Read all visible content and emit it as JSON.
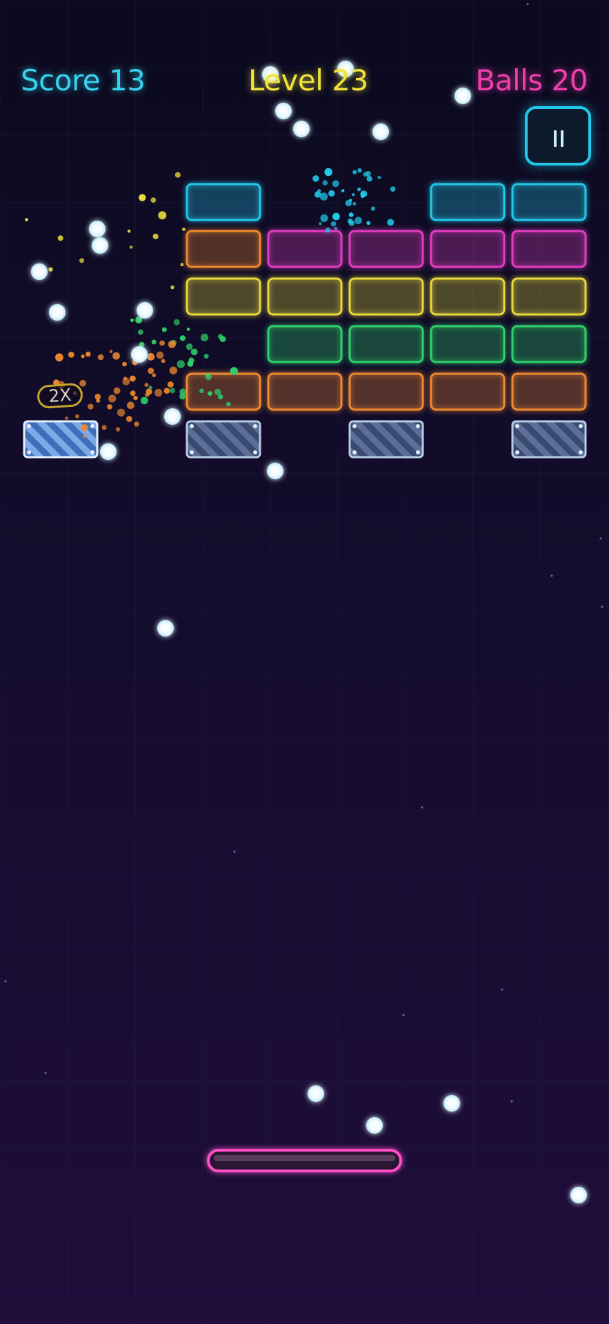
{
  "hud": {
    "score_text": "Score 13",
    "level_text": "Level 23",
    "balls_text": "Balls 20"
  },
  "powerup_multiplier": "2X",
  "colors": {
    "cyan": "#22c9ea",
    "magenta": "#e23cc0",
    "yellow": "#e9d83a",
    "green": "#2ed36b",
    "orange": "#f08a2e",
    "steel": "#c9dcf2",
    "paddle": "#ff4fc8"
  },
  "bricks": [
    {
      "row": 1,
      "col": 3,
      "color": "cyan"
    },
    {
      "row": 1,
      "col": 6,
      "color": "cyan"
    },
    {
      "row": 1,
      "col": 7,
      "color": "cyan"
    },
    {
      "row": 2,
      "col": 3,
      "color": "orange"
    },
    {
      "row": 2,
      "col": 4,
      "color": "magenta"
    },
    {
      "row": 2,
      "col": 5,
      "color": "magenta"
    },
    {
      "row": 2,
      "col": 6,
      "color": "magenta"
    },
    {
      "row": 2,
      "col": 7,
      "color": "magenta"
    },
    {
      "row": 3,
      "col": 3,
      "color": "yellow"
    },
    {
      "row": 3,
      "col": 4,
      "color": "yellow"
    },
    {
      "row": 3,
      "col": 5,
      "color": "yellow"
    },
    {
      "row": 3,
      "col": 6,
      "color": "yellow"
    },
    {
      "row": 3,
      "col": 7,
      "color": "yellow"
    },
    {
      "row": 4,
      "col": 4,
      "color": "green"
    },
    {
      "row": 4,
      "col": 5,
      "color": "green"
    },
    {
      "row": 4,
      "col": 6,
      "color": "green"
    },
    {
      "row": 4,
      "col": 7,
      "color": "green"
    },
    {
      "row": 5,
      "col": 3,
      "color": "orange"
    },
    {
      "row": 5,
      "col": 4,
      "color": "orange"
    },
    {
      "row": 5,
      "col": 5,
      "color": "orange"
    },
    {
      "row": 5,
      "col": 6,
      "color": "orange"
    },
    {
      "row": 5,
      "col": 7,
      "color": "orange"
    },
    {
      "row": 6,
      "col": 1,
      "color": "steel",
      "type": "steel"
    },
    {
      "row": 6,
      "col": 3,
      "color": "steel",
      "type": "steel"
    },
    {
      "row": 6,
      "col": 5,
      "color": "steel",
      "type": "steel"
    },
    {
      "row": 6,
      "col": 7,
      "color": "steel",
      "type": "steel"
    }
  ]
}
